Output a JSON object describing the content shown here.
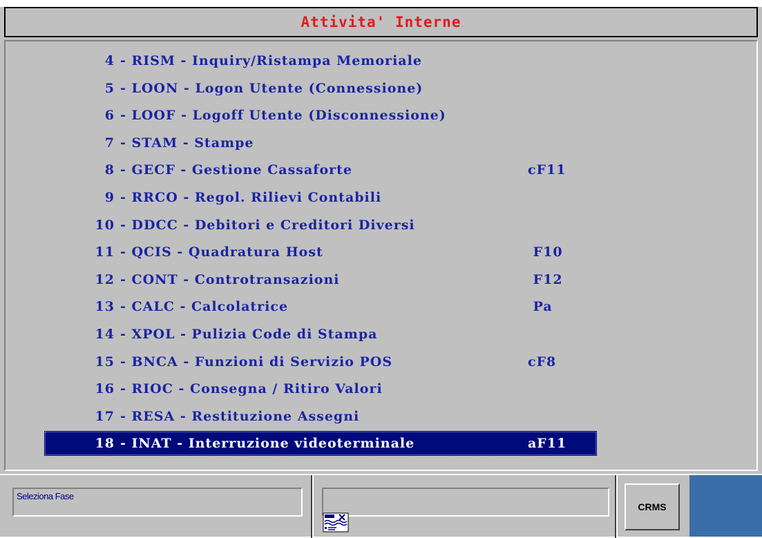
{
  "window": {
    "title": "Attivita' Interne"
  },
  "menu": {
    "items": [
      {
        "num": "4",
        "rest": "- RISM - Inquiry/Ristampa Memoriale",
        "key": ""
      },
      {
        "num": "5",
        "rest": "- LOON - Logon Utente (Connessione)",
        "key": ""
      },
      {
        "num": "6",
        "rest": "- LOOF - Logoff Utente (Disconnessione)",
        "key": ""
      },
      {
        "num": "7",
        "rest": "- STAM - Stampe",
        "key": ""
      },
      {
        "num": "8",
        "rest": "- GECF - Gestione Cassaforte",
        "key": "cF11"
      },
      {
        "num": "9",
        "rest": "- RRCO - Regol. Rilievi Contabili",
        "key": ""
      },
      {
        "num": "10",
        "rest": "- DDCC - Debitori e Creditori Diversi",
        "key": ""
      },
      {
        "num": "11",
        "rest": "- QCIS - Quadratura Host",
        "key": " F10"
      },
      {
        "num": "12",
        "rest": "- CONT - Controtransazioni",
        "key": " F12"
      },
      {
        "num": "13",
        "rest": "- CALC - Calcolatrice",
        "key": " Pa"
      },
      {
        "num": "14",
        "rest": "- XPOL - Pulizia Code di Stampa",
        "key": ""
      },
      {
        "num": "15",
        "rest": "- BNCA - Funzioni di Servizio POS",
        "key": "cF8"
      },
      {
        "num": "16",
        "rest": "- RIOC - Consegna / Ritiro Valori",
        "key": ""
      },
      {
        "num": "17",
        "rest": "- RESA - Restituzione Assegni",
        "key": ""
      },
      {
        "num": "18",
        "rest": "- INAT - Interruzione videoterminale",
        "key": "aF11"
      }
    ],
    "selected_index": 14
  },
  "status_bar": {
    "phase_text": "Seleziona Fase",
    "message_text": "",
    "crms_label": "CRMS"
  },
  "colors": {
    "background": "#c0c0c0",
    "title_text": "#e31a1c",
    "item_text": "#1a24a4",
    "selected_bg": "#000a7a",
    "selected_text": "#ffffff",
    "blue_panel": "#3a6ea8"
  },
  "icons": {
    "message_icon": "message-document-icon"
  }
}
